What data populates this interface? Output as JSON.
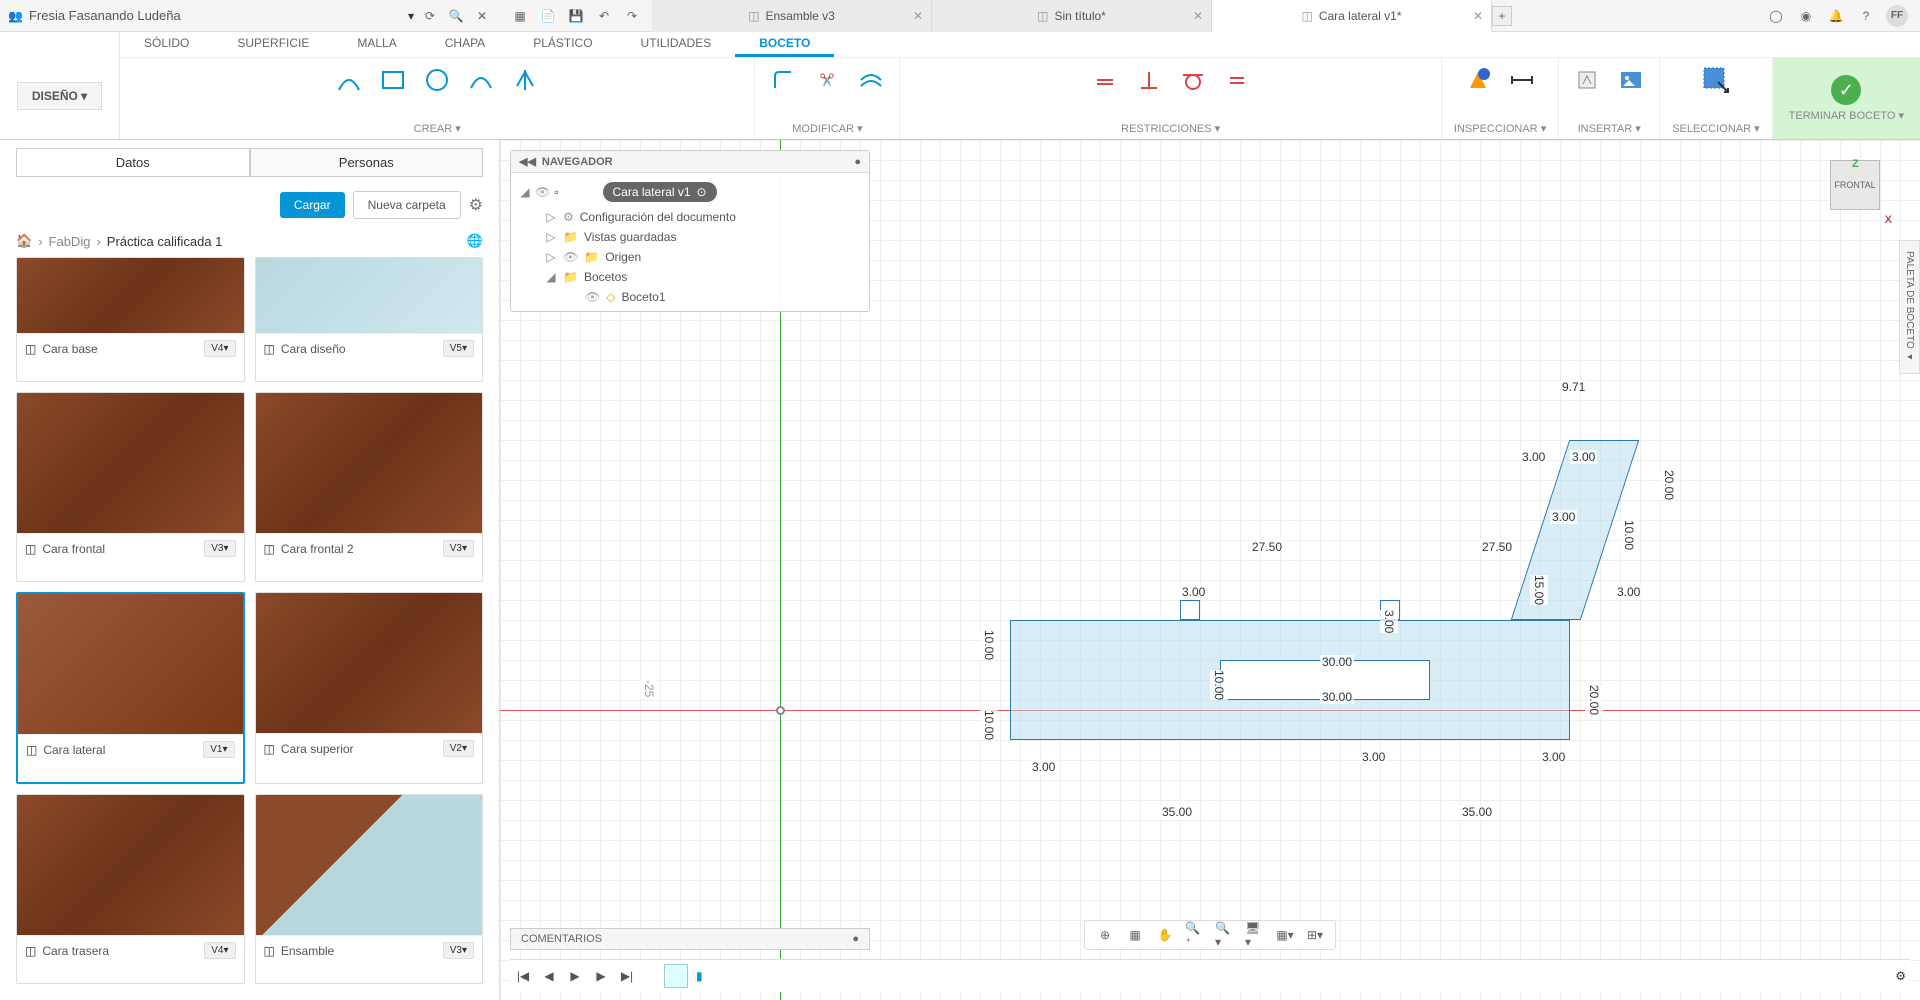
{
  "user": {
    "name": "Fresia Fasanando Ludeña",
    "initials": "FF"
  },
  "topbar": {
    "tabs": [
      {
        "label": "Ensamble v3",
        "active": false
      },
      {
        "label": "Sin título*",
        "active": false
      },
      {
        "label": "Cara lateral v1*",
        "active": true
      }
    ]
  },
  "ribbon": {
    "design_label": "DISEÑO",
    "tabs": [
      "SÓLIDO",
      "SUPERFICIE",
      "MALLA",
      "CHAPA",
      "PLÁSTICO",
      "UTILIDADES",
      "BOCETO"
    ],
    "active_tab": "BOCETO",
    "groups": {
      "crear": "CREAR",
      "modificar": "MODIFICAR",
      "restricciones": "RESTRICCIONES",
      "inspeccionar": "INSPECCIONAR",
      "insertar": "INSERTAR",
      "seleccionar": "SELECCIONAR",
      "terminar": "TERMINAR BOCETO"
    }
  },
  "data_panel": {
    "tabs": {
      "datos": "Datos",
      "personas": "Personas"
    },
    "buttons": {
      "cargar": "Cargar",
      "nueva_carpeta": "Nueva carpeta"
    },
    "breadcrumb": {
      "folder": "FabDig",
      "project": "Práctica calificada 1"
    },
    "thumbs": [
      {
        "name": "Cara base",
        "version": "V4"
      },
      {
        "name": "Cara diseño",
        "version": "V5"
      },
      {
        "name": "Cara frontal",
        "version": "V3"
      },
      {
        "name": "Cara frontal 2",
        "version": "V3"
      },
      {
        "name": "Cara lateral",
        "version": "V1"
      },
      {
        "name": "Cara superior",
        "version": "V2"
      },
      {
        "name": "Cara trasera",
        "version": "V4"
      },
      {
        "name": "Ensamble",
        "version": "V3"
      }
    ]
  },
  "browser": {
    "title": "NAVEGADOR",
    "root": "Cara lateral v1",
    "items": {
      "config": "Configuración del documento",
      "vistas": "Vistas guardadas",
      "origen": "Origen",
      "bocetos": "Bocetos",
      "boceto1": "Boceto1"
    }
  },
  "viewcube": {
    "face": "FRONTAL",
    "z": "Z",
    "x": "X"
  },
  "palette": {
    "label": "PALETA DE BOCETO"
  },
  "comments": {
    "label": "COMENTARIOS"
  },
  "dimensions": {
    "d1": "9.71",
    "d2": "3.00",
    "d3": "3.00",
    "d4": "20.00",
    "d5": "3.00",
    "d6": "10.00",
    "d7": "27.50",
    "d8": "27.50",
    "d9": "3.00",
    "d10": "15.00",
    "d11": "3.00",
    "d12": "10.00",
    "d13": "30.00",
    "d14": "30.00",
    "d15": "10.00",
    "d16": "20.00",
    "d17": "10.00",
    "d18": "3.00",
    "d19": "3.00",
    "d20": "3.00",
    "d21": "35.00",
    "d22": "35.00",
    "d23": "3.00",
    "ruler25": "-25"
  }
}
